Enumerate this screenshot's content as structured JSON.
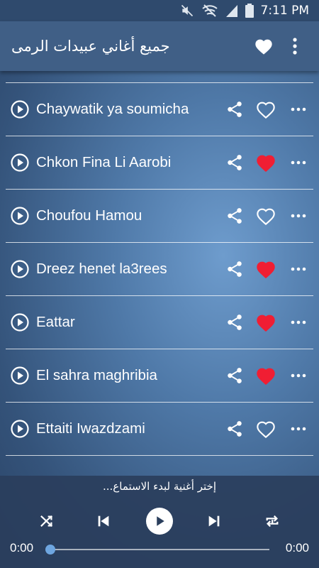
{
  "status_bar": {
    "time": "7:11 PM"
  },
  "app_bar": {
    "title": "جميع أغاني عبيدات الرمى"
  },
  "songs": [
    {
      "title": "Chaywatik ya soumicha",
      "favorite": false
    },
    {
      "title": "Chkon Fina Li Aarobi",
      "favorite": true
    },
    {
      "title": "Choufou Hamou",
      "favorite": false
    },
    {
      "title": "Dreez henet la3rees",
      "favorite": true
    },
    {
      "title": "Eattar",
      "favorite": true
    },
    {
      "title": "El sahra maghribia",
      "favorite": true
    },
    {
      "title": "Ettaiti Iwazdzami",
      "favorite": false
    }
  ],
  "player": {
    "status_text": "إختر أغنية لبدء الاستماع...",
    "elapsed": "0:00",
    "duration": "0:00",
    "progress": 0
  },
  "colors": {
    "favorite_active": "#f01e33",
    "seek_thumb": "#6ea6e0"
  }
}
